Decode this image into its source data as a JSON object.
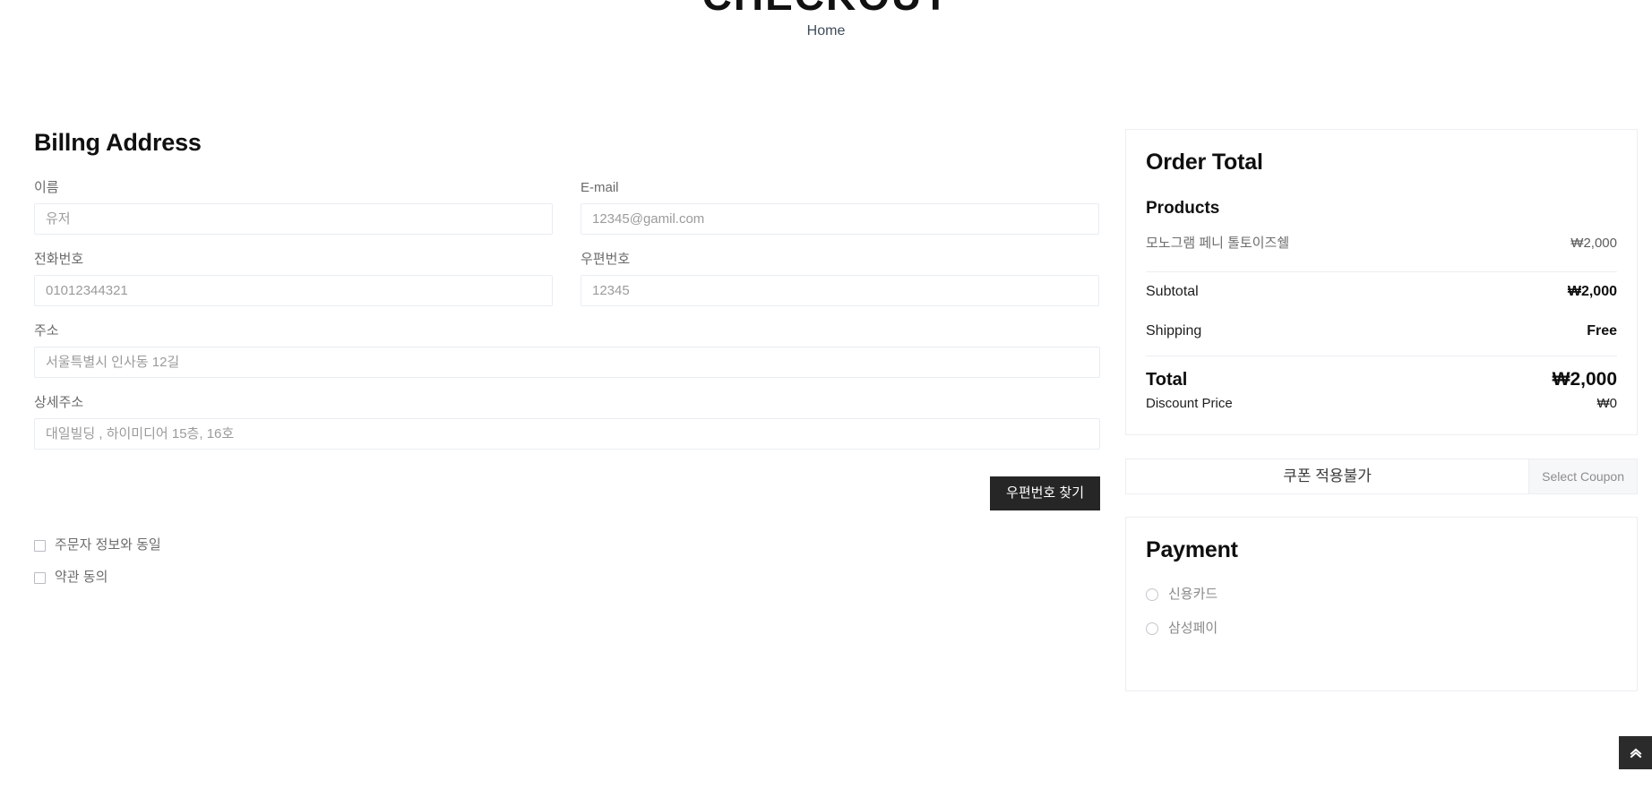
{
  "header": {
    "title": "CHECKOUT",
    "breadcrumb": "Home"
  },
  "billing": {
    "heading": "Billng Address",
    "fields": [
      {
        "label": "이름",
        "placeholder": "유저",
        "value": ""
      },
      {
        "label": "E-mail",
        "placeholder": "12345@gamil.com",
        "value": ""
      },
      {
        "label": "전화번호",
        "placeholder": "01012344321",
        "value": ""
      },
      {
        "label": "우편번호",
        "placeholder": "12345",
        "value": ""
      },
      {
        "label": "주소",
        "placeholder": "서울특별시 인사동 12길",
        "value": ""
      },
      {
        "label": "상세주소",
        "placeholder": "대일빌딩 , 하이미디어 15층, 16호",
        "value": ""
      }
    ],
    "find_postcode_button": "우편번호 찾기",
    "checkboxes": [
      {
        "label": "주문자 정보와 동일",
        "checked": false
      },
      {
        "label": "약관 동의",
        "checked": false
      }
    ]
  },
  "order_total": {
    "title": "Order Total",
    "products_heading": "Products",
    "products": [
      {
        "name": "모노그램 페니 톨토이즈쉘",
        "price": "₩2,000"
      }
    ],
    "summary": [
      {
        "label": "Subtotal",
        "value": "₩2,000"
      },
      {
        "label": "Shipping",
        "value": "Free"
      }
    ],
    "total": {
      "label": "Total",
      "value": "₩2,000"
    },
    "discount": {
      "label": "Discount Price",
      "value": "₩0"
    }
  },
  "coupon": {
    "placeholder": "쿠폰 적용불가",
    "value": "",
    "button_label": "Select Coupon"
  },
  "payment": {
    "title": "Payment",
    "methods": [
      {
        "label": "신용카드",
        "selected": false
      },
      {
        "label": "삼성페이",
        "selected": false
      }
    ]
  },
  "scroll_top": {
    "icon": "double-chevron-up-icon"
  },
  "colors": {
    "accent_dark": "#262626",
    "border": "#eceef1",
    "input_border": "#e8edf3",
    "muted_text": "#6a6a6a"
  }
}
